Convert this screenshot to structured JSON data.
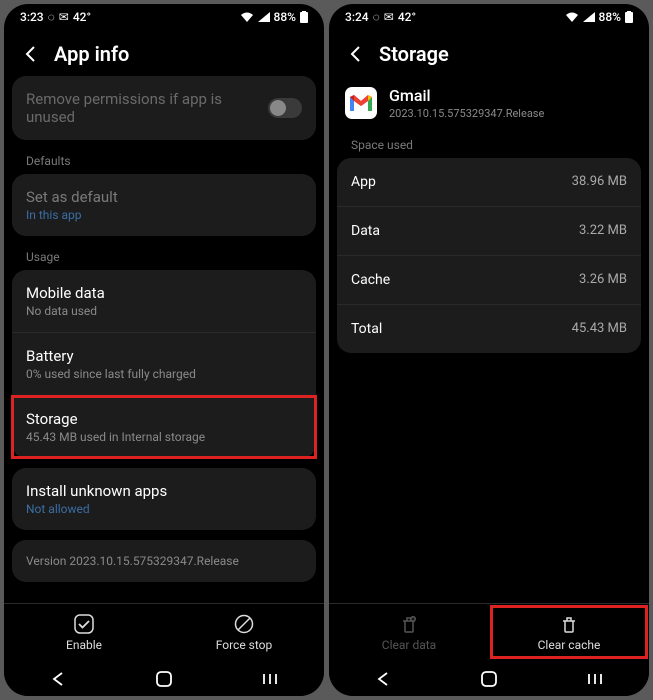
{
  "left": {
    "status": {
      "time": "3:23",
      "battery": "88%"
    },
    "header": "App info",
    "remove_perms": {
      "title": "Remove permissions if app is unused"
    },
    "defaults_label": "Defaults",
    "set_default": {
      "title": "Set as default",
      "sub": "In this app"
    },
    "usage_label": "Usage",
    "mobile_data": {
      "title": "Mobile data",
      "sub": "No data used"
    },
    "battery": {
      "title": "Battery",
      "sub": "0% used since last fully charged"
    },
    "storage": {
      "title": "Storage",
      "sub": "45.43 MB used in Internal storage"
    },
    "install_unknown": {
      "title": "Install unknown apps",
      "sub": "Not allowed"
    },
    "version": "Version 2023.10.15.575329347.Release",
    "actions": {
      "enable": "Enable",
      "force_stop": "Force stop"
    }
  },
  "right": {
    "status": {
      "time": "3:24",
      "battery": "88%"
    },
    "header": "Storage",
    "app": {
      "name": "Gmail",
      "version": "2023.10.15.575329347.Release"
    },
    "space_label": "Space used",
    "rows": {
      "app": {
        "label": "App",
        "value": "38.96 MB"
      },
      "data": {
        "label": "Data",
        "value": "3.22 MB"
      },
      "cache": {
        "label": "Cache",
        "value": "3.26 MB"
      },
      "total": {
        "label": "Total",
        "value": "45.43 MB"
      }
    },
    "actions": {
      "clear_data": "Clear data",
      "clear_cache": "Clear cache"
    }
  },
  "status_icons": {
    "msg": "✉",
    "img": "42°"
  }
}
